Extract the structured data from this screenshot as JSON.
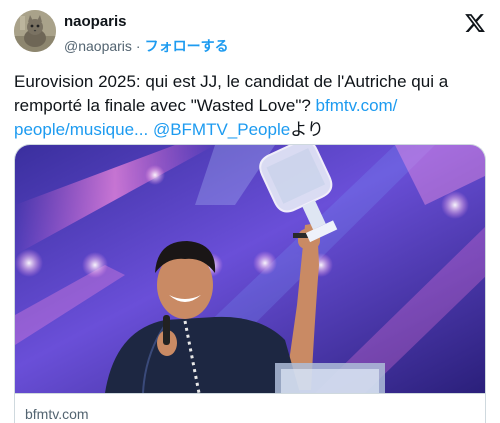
{
  "header": {
    "display_name": "naoparis",
    "handle": "@naoparis",
    "separator": "·",
    "follow_label": "フォローする",
    "x_logo_icon": "x-logo-icon"
  },
  "tweet": {
    "text_main": "Eurovision 2025: qui est JJ, le candidat de l'Autriche qui a remporté la finale avec \"Wasted Love\"? ",
    "link_url": "bfmtv.com/ people/musique...",
    "mention": "@BFMTV_People",
    "suffix": "より"
  },
  "media": {
    "image_subject": "singer holding trophy on stage",
    "domain": "bfmtv.com"
  },
  "colors": {
    "link": "#1d9bf0",
    "text": "#0f1419",
    "secondary": "#536471",
    "border": "#cfd9de"
  }
}
